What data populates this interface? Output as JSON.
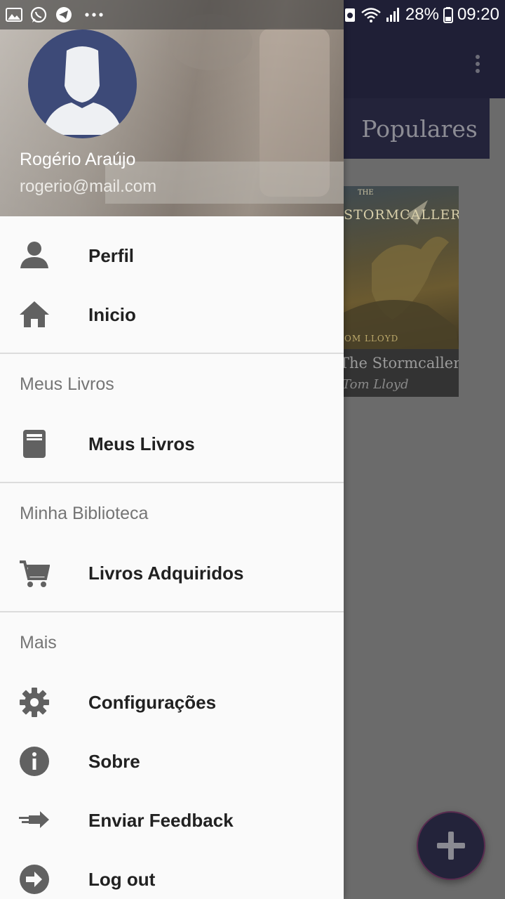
{
  "status_bar": {
    "battery_percent": "28%",
    "time": "09:20",
    "notification_icons": [
      "gallery-icon",
      "whatsapp-icon",
      "telegram-icon",
      "more-icon"
    ]
  },
  "background": {
    "tab_label": "Populares",
    "book": {
      "cover_series": "THE",
      "cover_title": "STORMCALLER",
      "cover_author": "TOM LLOYD",
      "title": "The Stormcaller",
      "author": "Tom Lloyd"
    }
  },
  "drawer": {
    "user": {
      "name": "Rogério Araújo",
      "email": "rogerio@mail.com"
    },
    "items_top": [
      {
        "label": "Perfil",
        "icon": "person-icon"
      },
      {
        "label": "Inicio",
        "icon": "home-icon"
      }
    ],
    "section_books": {
      "title": "Meus Livros",
      "items": [
        {
          "label": "Meus Livros",
          "icon": "book-icon"
        }
      ]
    },
    "section_library": {
      "title": "Minha Biblioteca",
      "items": [
        {
          "label": "Livros Adquiridos",
          "icon": "cart-icon"
        }
      ]
    },
    "section_more": {
      "title": "Mais",
      "items": [
        {
          "label": "Configurações",
          "icon": "gear-icon"
        },
        {
          "label": "Sobre",
          "icon": "info-icon"
        },
        {
          "label": "Enviar Feedback",
          "icon": "send-icon"
        },
        {
          "label": "Log out",
          "icon": "logout-icon"
        }
      ]
    }
  },
  "colors": {
    "toolbar": "#1f1f36",
    "drawer_bg": "#fafafa",
    "icon_gray": "#616161",
    "section_title": "#757575",
    "avatar_bg": "#3d4a78"
  }
}
